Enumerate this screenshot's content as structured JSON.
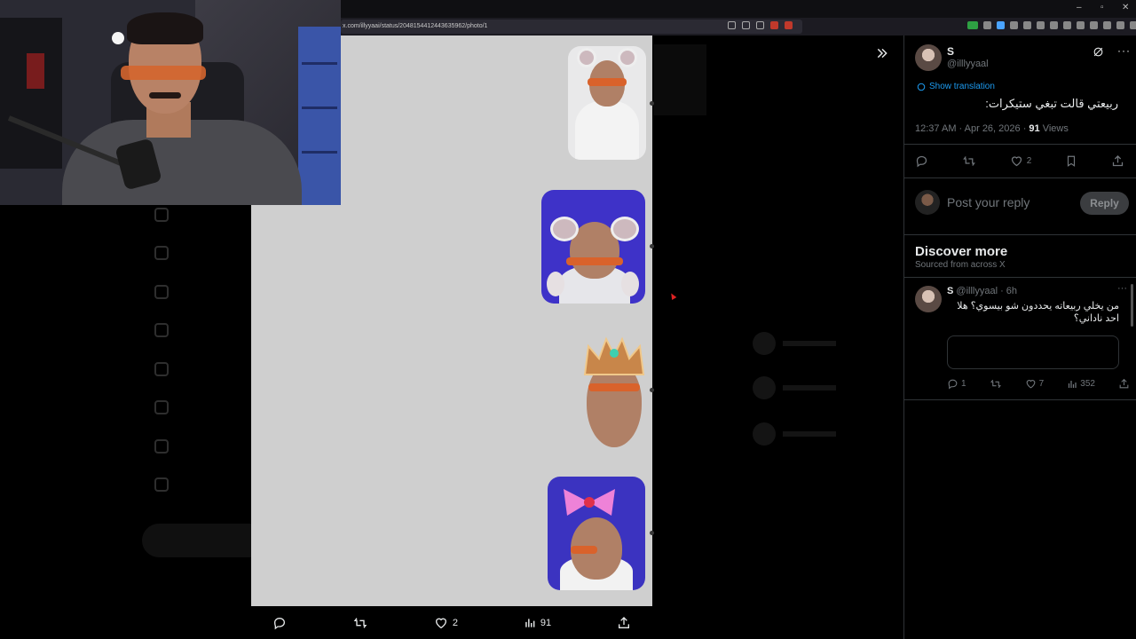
{
  "browser": {
    "url": "x.com/illyyaai/status/2048154412443635962/photo/1",
    "window_controls": [
      "–",
      "▫",
      "✕"
    ]
  },
  "viewer": {
    "actions": {
      "reply_count": "",
      "repost_count": "",
      "like_count": "2",
      "views_count": "91"
    }
  },
  "tweet": {
    "author_name": "S",
    "author_handle": "@illlyyaal",
    "show_translation": "Show translation",
    "text": "ربيعتي قالت تبغي ستيكرات:",
    "timestamp": "12:37 AM · Apr 26, 2026 · ",
    "views": "91",
    "views_label": " Views",
    "like_count": "2",
    "reply_placeholder": "Post your reply",
    "reply_button": "Reply"
  },
  "discover": {
    "title": "Discover more",
    "subtitle": "Sourced from across X",
    "post": {
      "author_name": "S",
      "author_handle": "@illlyyaal · 6h",
      "text": "من يخلي ربيعاته يحددون شو  بيسوي؟ هلا احد ناداني؟",
      "reply_count": "1",
      "repost_count": "",
      "like_count": "7",
      "views_count": "352"
    }
  },
  "icons": {
    "reply": "reply-icon",
    "repost": "repost-icon",
    "like": "heart-icon",
    "views": "views-icon",
    "share": "share-icon",
    "bookmark": "bookmark-icon",
    "collapse": "double-chevron-right-icon",
    "grok": "grok-icon",
    "translate": "globe-icon"
  },
  "colors": {
    "link": "#1d9bf0",
    "muted": "#71767b",
    "text": "#e7e9ea",
    "viewer_bg": "#cfcfcf"
  }
}
